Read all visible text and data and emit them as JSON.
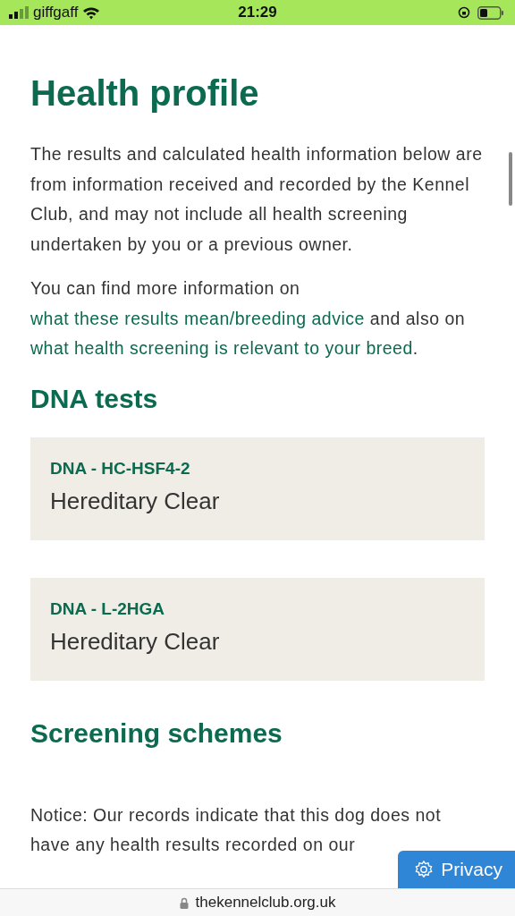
{
  "status_bar": {
    "carrier": "giffgaff",
    "time": "21:29"
  },
  "title": "Health profile",
  "intro": "The results and calculated health information below are from information received and recorded by the Kennel Club, and may not include all health screening undertaken by you or a previous owner.",
  "info": [
    {
      "text": "You can find more information on ",
      "link": false
    },
    {
      "text": "what these",
      "link": true
    },
    {
      "text": "results mean/breeding advice",
      "link": true
    },
    {
      "text": " and also on ",
      "link": false
    },
    {
      "text": "what",
      "link": true
    },
    {
      "text": "health screening is relevant to your breed",
      "link": true
    },
    {
      "text": ".",
      "link": false
    }
  ],
  "dna_heading": "DNA tests",
  "dna_tests": [
    {
      "name": "DNA - HC-HSF4-2",
      "result": "Hereditary Clear"
    },
    {
      "name": "DNA - L-2HGA",
      "result": "Hereditary Clear"
    }
  ],
  "screening_heading": "Screening schemes",
  "notice": "Notice: Our records indicate that this dog does not have any health results recorded on our",
  "privacy_button": "Privacy",
  "address_bar": {
    "url": "thekennelclub.org.uk"
  }
}
